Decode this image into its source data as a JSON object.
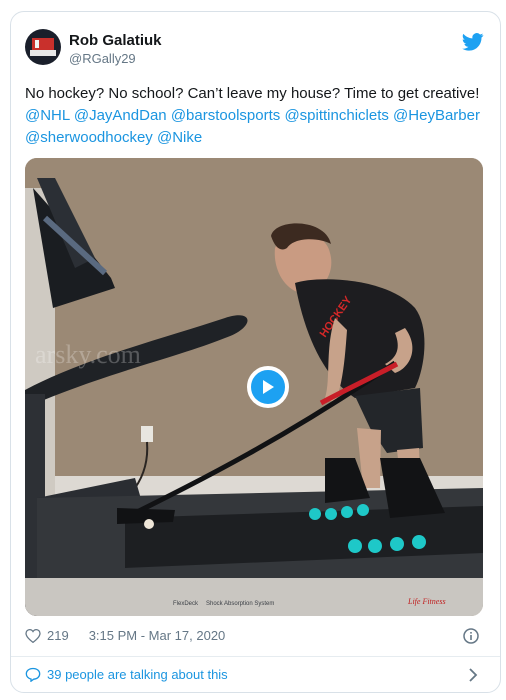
{
  "tweet": {
    "author_name": "Rob Galatiuk",
    "author_handle": "@RGally29",
    "text_start": "No hockey? No school? Can’t leave my house? Time to get creative! ",
    "mentions": [
      "@NHL",
      "@JayAndDan",
      "@barstoolsports",
      "@spittinchiclets",
      "@HeyBarber",
      "@sherwoodhockey",
      "@Nike"
    ],
    "likes": "219",
    "timestamp": "3:15 PM - Mar 17, 2020",
    "talking": "39 people are talking about this"
  },
  "media": {
    "watermark": "arsky.com",
    "treadmill_brand": "Life Fitness",
    "treadmill_model": "FlexDeck",
    "treadmill_subtext": "Shock Absorption System",
    "shirt_text": "HOCKEY"
  },
  "colors": {
    "accent": "#1da1f2",
    "link": "#1b95e0",
    "text": "#14171a",
    "muted": "#657786"
  },
  "icons": [
    "twitter-bird-icon",
    "play-icon",
    "heart-icon",
    "info-icon",
    "comment-icon",
    "chevron-right-icon"
  ]
}
